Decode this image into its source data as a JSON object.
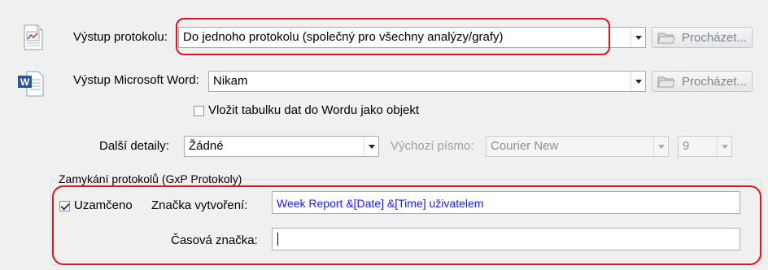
{
  "report_output": {
    "label": "Výstup protokolu:",
    "value": "Do jednoho protokolu (společný pro všechny analýzy/grafy)",
    "browse_label": "Procházet..."
  },
  "word_output": {
    "label": "Výstup Microsoft Word:",
    "value": "Nikam",
    "browse_label": "Procházet...",
    "embed_checkbox_label": "Vložit tabulku dat do Wordu jako objekt",
    "embed_checked": false
  },
  "details": {
    "label": "Další detaily:",
    "value": "Žádné",
    "font_label": "Výchozí písmo:",
    "font_value": "Courier New",
    "font_size_value": "9"
  },
  "locking": {
    "group_title": "Zamykání protokolů (GxP Protokoly)",
    "locked_label": "Uzamčeno",
    "locked_checked": true,
    "stamp_label": "Značka vytvoření:",
    "stamp_value": "Week Report &[Date] &[Time] uživatelem",
    "time_stamp_label": "Časová značka:",
    "time_stamp_value": ""
  },
  "colors": {
    "highlight": "#e3141b",
    "field_text": "#1a1aff"
  }
}
